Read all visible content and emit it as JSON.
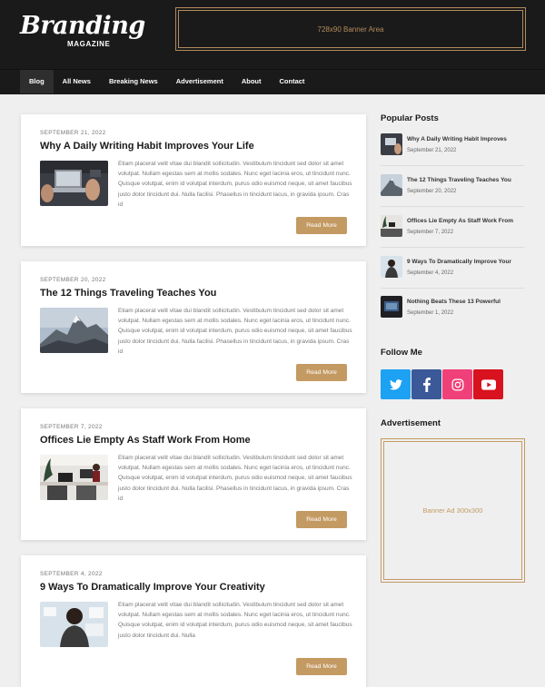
{
  "header": {
    "logo_main": "Branding",
    "logo_sub": "MAGAZINE",
    "banner_text": "728x90 Banner Area"
  },
  "nav": {
    "items": [
      {
        "label": "Blog",
        "active": true
      },
      {
        "label": "All News"
      },
      {
        "label": "Breaking News"
      },
      {
        "label": "Advertisement"
      },
      {
        "label": "About"
      },
      {
        "label": "Contact"
      }
    ]
  },
  "posts": [
    {
      "date": "SEPTEMBER 21, 2022",
      "title": "Why A Daily Writing Habit Improves Your Life",
      "excerpt": "Etiam placerat velit vitae dui blandit sollicitudin. Vestibulum tincidunt sed dolor sit amet volutpat. Nullam egestas sem at mollis sodales. Nunc eget lacinia eros, ut tincidunt nunc. Quisque volutpat, enim id volutpat interdum, purus odio euismod neque, sit amet faucibus justo dolor tincidunt dui. Nulla facilisi. Phasellus in tincidunt lacus, in gravida ipsum. Cras id",
      "button": "Read More",
      "thumb": "laptop-image"
    },
    {
      "date": "SEPTEMBER 20, 2022",
      "title": "The 12 Things Traveling Teaches You",
      "excerpt": "Etiam placerat velit vitae dui blandit sollicitudin. Vestibulum tincidunt sed dolor sit amet volutpat. Nullam egestas sem at mollis sodales. Nunc eget lacinia eros, ut tincidunt nunc. Quisque volutpat, enim id volutpat interdum, purus odio euismod neque, sit amet faucibus justo dolor tincidunt dui. Nulla facilisi. Phasellus in tincidunt lacus, in gravida ipsum. Cras id",
      "button": "Read More",
      "thumb": "mountain-image"
    },
    {
      "date": "SEPTEMBER 7, 2022",
      "title": "Offices Lie Empty As Staff Work From Home",
      "excerpt": "Etiam placerat velit vitae dui blandit sollicitudin. Vestibulum tincidunt sed dolor sit amet volutpat. Nullam egestas sem at mollis sodales. Nunc eget lacinia eros, ut tincidunt nunc. Quisque volutpat, enim id volutpat interdum, purus odio euismod neque, sit amet faucibus justo dolor tincidunt dui. Nulla facilisi. Phasellus in tincidunt lacus, in gravida ipsum. Cras id",
      "button": "Read More",
      "thumb": "office-image"
    },
    {
      "date": "SEPTEMBER 4, 2022",
      "title": "9 Ways To Dramatically Improve Your Creativity",
      "excerpt": "Etiam placerat velit vitae dui blandit sollicitudin. Vestibulum tincidunt sed dolor sit amet volutpat. Nullam egestas sem at mollis sodales. Nunc eget lacinia eros, ut tincidunt nunc. Quisque volutpat, enim id volutpat interdum, purus odio euismod neque, sit amet faucibus justo dolor tincidunt dui. Nulla",
      "button": "Read More",
      "thumb": "creative-image"
    }
  ],
  "sidebar": {
    "popular_title": "Popular Posts",
    "popular": [
      {
        "title": "Why A Daily Writing Habit Improves",
        "date": "September 21, 2022"
      },
      {
        "title": "The 12 Things Traveling Teaches You",
        "date": "September 20, 2022"
      },
      {
        "title": "Offices Lie Empty As Staff Work From",
        "date": "September 7, 2022"
      },
      {
        "title": "9 Ways To Dramatically Improve Your",
        "date": "September 4, 2022"
      },
      {
        "title": "Nothing Beats These 13 Powerful",
        "date": "September 1, 2022"
      }
    ],
    "follow_title": "Follow Me",
    "social": [
      {
        "icon": "twitter-icon",
        "color": "#1da1f2"
      },
      {
        "icon": "facebook-icon",
        "color": "#3b5998"
      },
      {
        "icon": "instagram-icon",
        "color": "#f0407a"
      },
      {
        "icon": "youtube-icon",
        "color": "#d8121e"
      }
    ],
    "ad_title": "Advertisement",
    "ad_text": "Banner Ad 300x300"
  },
  "colors": {
    "accent": "#c49a63",
    "header_bg": "#1a1a1a",
    "page_bg": "#efefef"
  }
}
